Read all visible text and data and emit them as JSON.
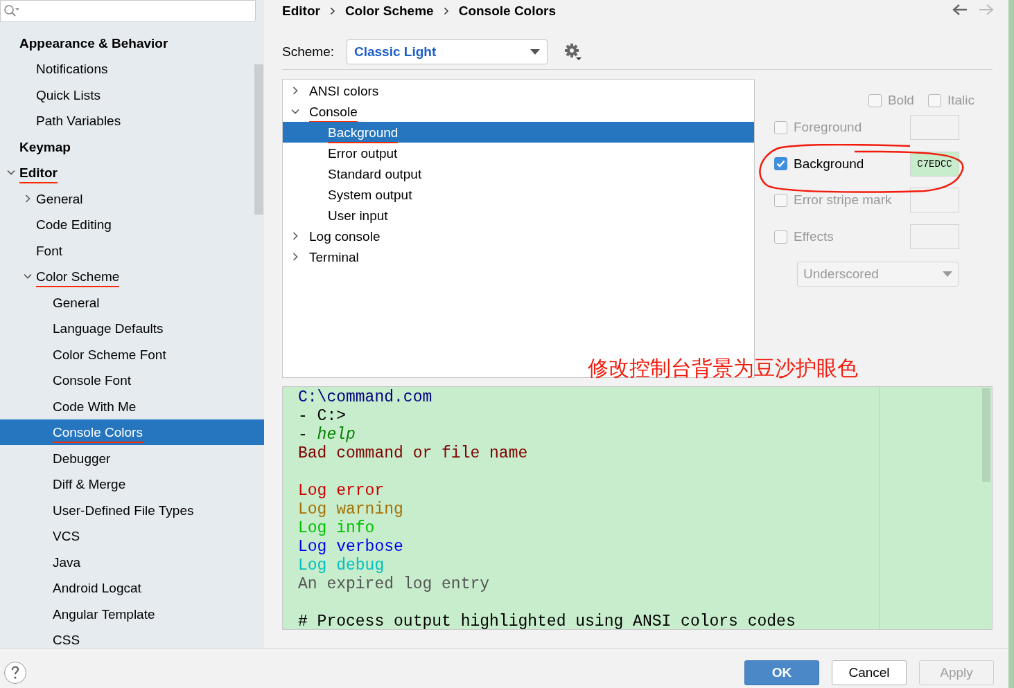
{
  "sidebar": {
    "items": [
      {
        "label": "Appearance & Behavior",
        "bold": true,
        "children": [
          {
            "label": "Notifications"
          },
          {
            "label": "Quick Lists"
          },
          {
            "label": "Path Variables"
          }
        ]
      },
      {
        "label": "Keymap",
        "bold": true
      },
      {
        "label": "Editor",
        "bold": true,
        "expanded": true,
        "annotated": true,
        "children": [
          {
            "label": "General",
            "expanded": false
          },
          {
            "label": "Code Editing"
          },
          {
            "label": "Font"
          },
          {
            "label": "Color Scheme",
            "expanded": true,
            "annotated": true,
            "children": [
              {
                "label": "General",
                "selected": false
              },
              {
                "label": "Language Defaults",
                "selected": false
              },
              {
                "label": "Color Scheme Font",
                "selected": false
              },
              {
                "label": "Console Font",
                "selected": false
              },
              {
                "label": "Code With Me",
                "selected": false
              },
              {
                "label": "Console Colors",
                "selected": true,
                "annotated": true
              },
              {
                "label": "Debugger",
                "selected": false
              },
              {
                "label": "Diff & Merge",
                "selected": false
              },
              {
                "label": "User-Defined File Types",
                "selected": false
              },
              {
                "label": "VCS",
                "selected": false
              },
              {
                "label": "Java",
                "selected": false
              },
              {
                "label": "Android Logcat",
                "selected": false
              },
              {
                "label": "Angular Template",
                "selected": false
              },
              {
                "label": "CSS",
                "selected": false
              }
            ]
          }
        ]
      }
    ]
  },
  "breadcrumb": [
    "Editor",
    "Color Scheme",
    "Console Colors"
  ],
  "scheme": {
    "label": "Scheme:",
    "value": "Classic Light"
  },
  "tree": [
    {
      "label": "ANSI colors",
      "expanded": false
    },
    {
      "label": "Console",
      "expanded": true,
      "annotated": true,
      "children": [
        {
          "label": "Background",
          "selected": true,
          "annotated": true
        },
        {
          "label": "Error output",
          "selected": false
        },
        {
          "label": "Standard output",
          "selected": false
        },
        {
          "label": "System output",
          "selected": false
        },
        {
          "label": "User input",
          "selected": false
        }
      ]
    },
    {
      "label": "Log console",
      "expanded": false
    },
    {
      "label": "Terminal",
      "expanded": false
    }
  ],
  "font_style": [
    {
      "label": "Bold",
      "checked": false
    },
    {
      "label": "Italic",
      "checked": false
    }
  ],
  "attributes": [
    {
      "label": "Foreground",
      "checked": false
    },
    {
      "label": "Background",
      "checked": true,
      "value": "C7EDCC",
      "color": "#c7edcc"
    },
    {
      "label": "Error stripe mark",
      "checked": false
    },
    {
      "label": "Effects",
      "checked": false
    }
  ],
  "effect_type": {
    "value": "Underscored",
    "disabled": true
  },
  "annotation": {
    "caption": "修改控制台背景为豆沙护眼色"
  },
  "preview": {
    "lines": [
      {
        "kind": "text",
        "segments": [
          {
            "text": "C:\\command.com",
            "color": "#000080"
          }
        ]
      },
      {
        "kind": "text",
        "segments": [
          {
            "text": "- C:>",
            "color": "#000000"
          }
        ]
      },
      {
        "kind": "text",
        "segments": [
          {
            "text": "- ",
            "color": "#000000"
          },
          {
            "text": "help",
            "color": "#008000",
            "italic": true
          }
        ]
      },
      {
        "kind": "text",
        "segments": [
          {
            "text": "Bad command or file name",
            "color": "#800000"
          }
        ]
      },
      {
        "kind": "blank"
      },
      {
        "kind": "text",
        "segments": [
          {
            "text": "Log error",
            "color": "#cc0000"
          }
        ]
      },
      {
        "kind": "text",
        "segments": [
          {
            "text": "Log warning",
            "color": "#a66f00"
          }
        ]
      },
      {
        "kind": "text",
        "segments": [
          {
            "text": "Log info",
            "color": "#00c000"
          }
        ]
      },
      {
        "kind": "text",
        "segments": [
          {
            "text": "Log verbose",
            "color": "#0000ee"
          }
        ]
      },
      {
        "kind": "text",
        "segments": [
          {
            "text": "Log debug",
            "color": "#00c0c0"
          }
        ]
      },
      {
        "kind": "text",
        "segments": [
          {
            "text": "An expired log entry",
            "color": "#555555"
          }
        ]
      },
      {
        "kind": "blank"
      },
      {
        "kind": "text",
        "segments": [
          {
            "text": "# Process output highlighted using ANSI colors codes",
            "color": "#000000"
          }
        ]
      }
    ]
  },
  "buttons": [
    {
      "label": "OK",
      "kind": "primary"
    },
    {
      "label": "Cancel",
      "kind": "normal"
    },
    {
      "label": "Apply",
      "kind": "disabled"
    }
  ]
}
